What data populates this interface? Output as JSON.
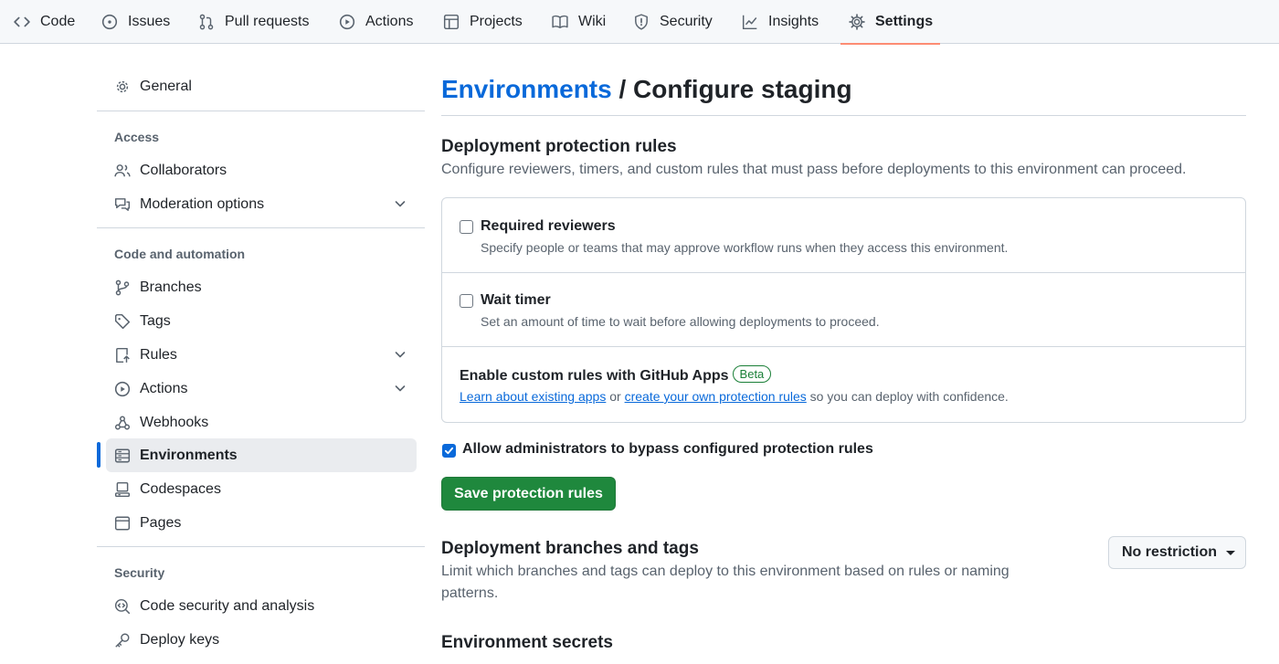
{
  "topnav": {
    "tabs": [
      {
        "label": "Code",
        "icon": "code-icon"
      },
      {
        "label": "Issues",
        "icon": "issue-opened-icon"
      },
      {
        "label": "Pull requests",
        "icon": "git-pull-request-icon"
      },
      {
        "label": "Actions",
        "icon": "play-icon"
      },
      {
        "label": "Projects",
        "icon": "table-icon"
      },
      {
        "label": "Wiki",
        "icon": "book-icon"
      },
      {
        "label": "Security",
        "icon": "shield-icon"
      },
      {
        "label": "Insights",
        "icon": "graph-icon"
      },
      {
        "label": "Settings",
        "icon": "gear-icon"
      }
    ],
    "active": "Settings",
    "accent_color": "#fd8c73"
  },
  "sidebar": {
    "general": "General",
    "access_heading": "Access",
    "access_items": [
      {
        "label": "Collaborators",
        "icon": "people-icon"
      },
      {
        "label": "Moderation options",
        "icon": "comment-discussion-icon",
        "expandable": true
      }
    ],
    "code_heading": "Code and automation",
    "code_items": [
      {
        "label": "Branches",
        "icon": "git-branch-icon"
      },
      {
        "label": "Tags",
        "icon": "tag-icon"
      },
      {
        "label": "Rules",
        "icon": "repo-push-icon",
        "expandable": true
      },
      {
        "label": "Actions",
        "icon": "play-icon",
        "expandable": true
      },
      {
        "label": "Webhooks",
        "icon": "webhook-icon"
      },
      {
        "label": "Environments",
        "icon": "server-icon",
        "selected": true
      },
      {
        "label": "Codespaces",
        "icon": "codespaces-icon"
      },
      {
        "label": "Pages",
        "icon": "browser-icon"
      }
    ],
    "security_heading": "Security",
    "security_items": [
      {
        "label": "Code security and analysis",
        "icon": "codescan-icon"
      },
      {
        "label": "Deploy keys",
        "icon": "key-icon"
      }
    ]
  },
  "main": {
    "breadcrumb_link": "Environments",
    "breadcrumb_sep": " / ",
    "title": "Configure staging",
    "protection": {
      "heading": "Deployment protection rules",
      "description": "Configure reviewers, timers, and custom rules that must pass before deployments to this environment can proceed.",
      "rules": [
        {
          "title": "Required reviewers",
          "description": "Specify people or teams that may approve workflow runs when they access this environment.",
          "checked": false
        },
        {
          "title": "Wait timer",
          "description": "Set an amount of time to wait before allowing deployments to proceed.",
          "checked": false
        }
      ],
      "custom": {
        "title": "Enable custom rules with GitHub Apps",
        "badge": "Beta",
        "link1": "Learn about existing apps",
        "or_text": " or ",
        "link2": "create your own protection rules",
        "suffix": " so you can deploy with confidence."
      },
      "bypass_label": "Allow administrators to bypass configured protection rules",
      "bypass_checked": true,
      "save_button": "Save protection rules"
    },
    "branches": {
      "heading": "Deployment branches and tags",
      "description": "Limit which branches and tags can deploy to this environment based on rules or naming patterns.",
      "select_value": "No restriction"
    },
    "secrets": {
      "heading": "Environment secrets"
    }
  },
  "colors": {
    "link": "#0969da",
    "primary_button": "#1f883d",
    "beta_badge": "#1a7f37",
    "selected_bar": "#0969da"
  }
}
